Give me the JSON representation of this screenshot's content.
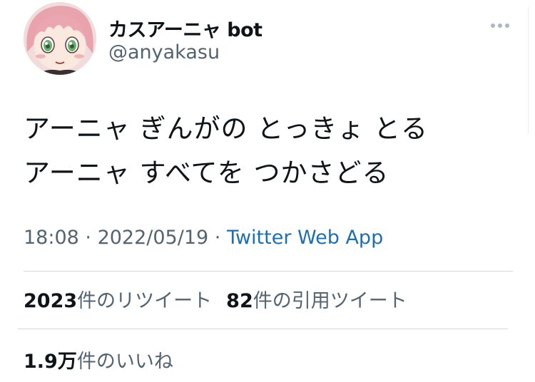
{
  "author": {
    "display_name": "カスアーニャ bot",
    "handle": "@anyakasu",
    "avatar_icon": "avatar-anime-girl-pink-hair"
  },
  "tweet": {
    "lines": [
      "アーニャ ぎんがの とっきょ とる",
      "アーニャ すべてを つかさどる"
    ]
  },
  "meta": {
    "time": "18:08",
    "separator": " · ",
    "date": "2022/05/19",
    "source": "Twitter Web App"
  },
  "stats": {
    "retweets": {
      "count": "2023",
      "label": "件のリツイート"
    },
    "quotes": {
      "count": "82",
      "label": "件の引用ツイート"
    },
    "likes": {
      "count": "1.9万",
      "label": "件のいいね"
    }
  },
  "colors": {
    "text": "#0f1419",
    "secondary": "#536471",
    "link": "#1d6fb0",
    "divider": "#cfd9de"
  }
}
